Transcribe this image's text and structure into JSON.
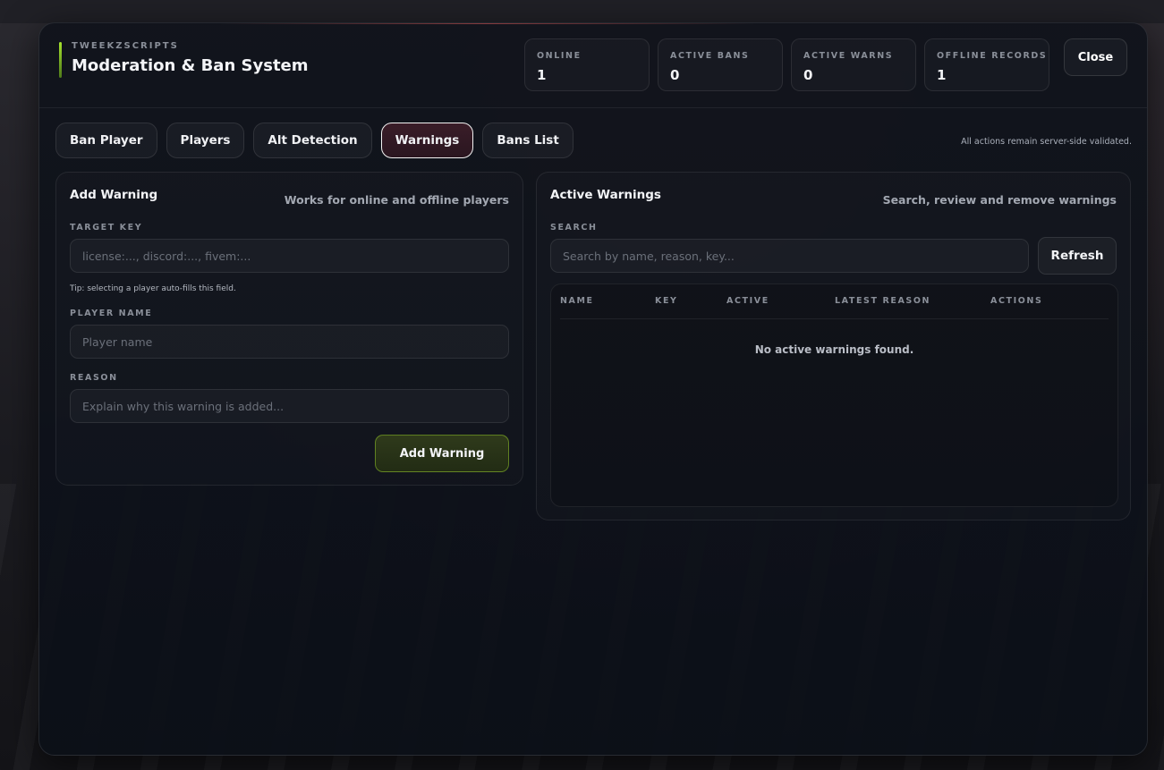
{
  "header": {
    "brand_sub": "TWEEKZSCRIPTS",
    "title": "Moderation & Ban System",
    "stats": [
      {
        "label": "ONLINE",
        "value": "1"
      },
      {
        "label": "ACTIVE BANS",
        "value": "0"
      },
      {
        "label": "ACTIVE WARNS",
        "value": "0"
      },
      {
        "label": "OFFLINE RECORDS",
        "value": "1"
      }
    ],
    "close_label": "Close"
  },
  "tabs": [
    {
      "label": "Ban Player"
    },
    {
      "label": "Players"
    },
    {
      "label": "Alt Detection"
    },
    {
      "label": "Warnings"
    },
    {
      "label": "Bans List"
    }
  ],
  "active_tab": "Warnings",
  "note": "All actions remain server-side validated.",
  "add_warning": {
    "title": "Add Warning",
    "subtitle": "Works for online and offline players",
    "target_key_label": "TARGET KEY",
    "target_key_placeholder": "license:..., discord:..., fivem:...",
    "tip": "Tip: selecting a player auto-fills this field.",
    "player_name_label": "PLAYER NAME",
    "player_name_placeholder": "Player name",
    "reason_label": "REASON",
    "reason_placeholder": "Explain why this warning is added...",
    "submit_label": "Add Warning"
  },
  "active_warnings": {
    "title": "Active Warnings",
    "subtitle": "Search, review and remove warnings",
    "search_label": "SEARCH",
    "search_placeholder": "Search by name, reason, key...",
    "refresh_label": "Refresh",
    "columns": [
      "NAME",
      "KEY",
      "ACTIVE",
      "LATEST REASON",
      "ACTIONS"
    ],
    "empty_text": "No active warnings found."
  },
  "colors": {
    "accent_green": "#a6e22e",
    "active_tab_bg": "#3a1d28"
  }
}
